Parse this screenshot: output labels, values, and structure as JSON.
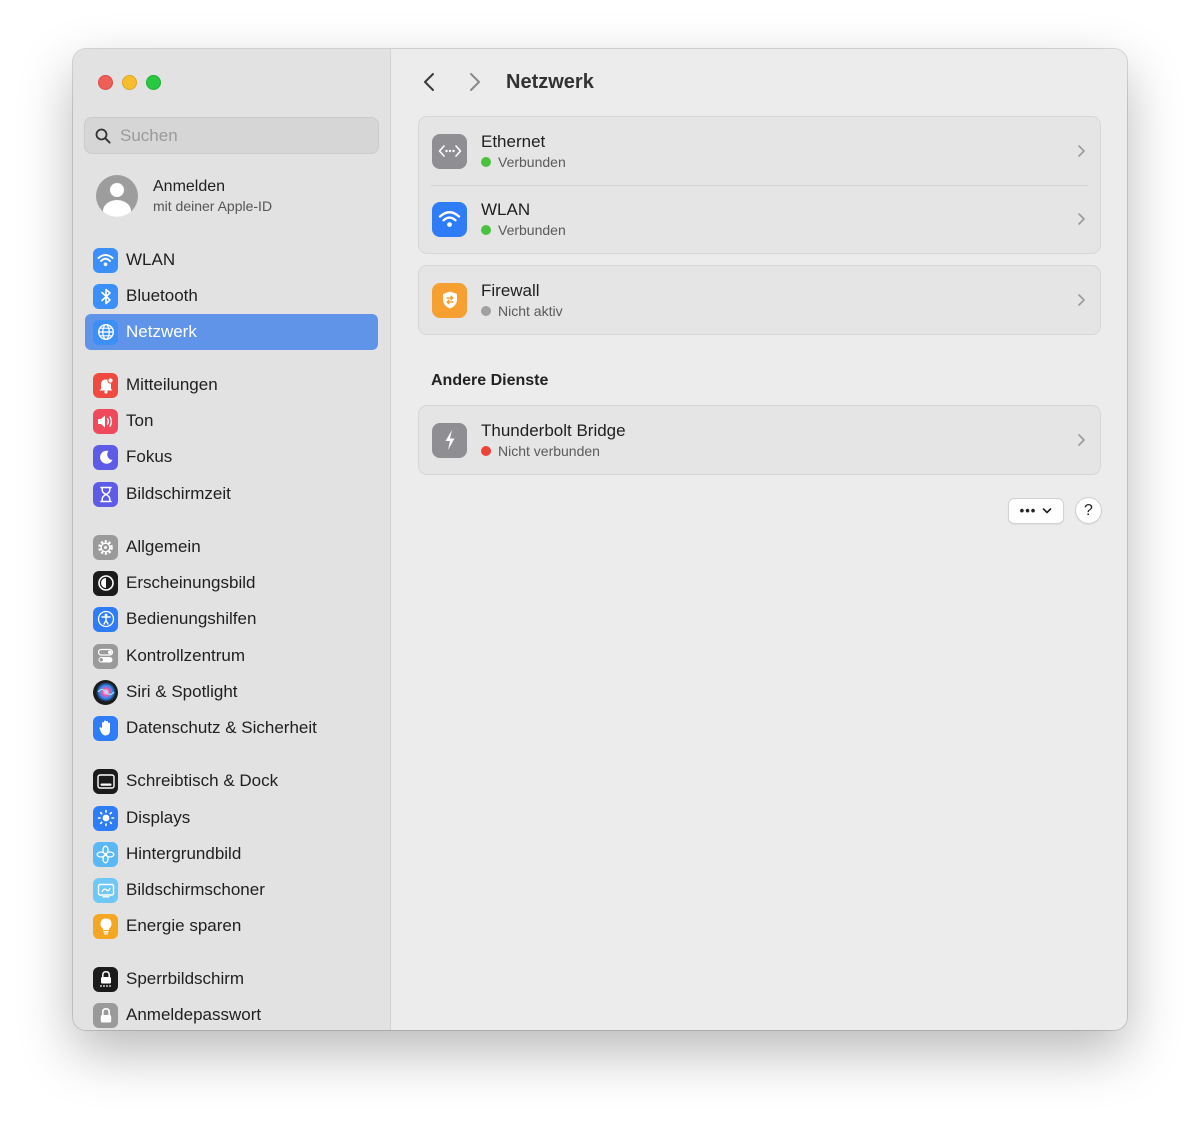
{
  "window": {
    "traffic_lights": [
      "close",
      "minimize",
      "zoom"
    ]
  },
  "sidebar": {
    "search": {
      "placeholder": "Suchen",
      "value": ""
    },
    "account": {
      "title": "Anmelden",
      "subtitle": "mit deiner Apple-ID"
    },
    "items": [
      {
        "label": "WLAN",
        "icon": "wifi-icon",
        "color": "#3b8ff7",
        "active": false
      },
      {
        "label": "Bluetooth",
        "icon": "bluetooth-icon",
        "color": "#3b8ff7",
        "active": false
      },
      {
        "label": "Netzwerk",
        "icon": "globe-icon",
        "color": "#3b8ff7",
        "active": true
      },
      {
        "label": "Mitteilungen",
        "icon": "bell-icon",
        "color": "#ef4a42",
        "active": false
      },
      {
        "label": "Ton",
        "icon": "speaker-icon",
        "color": "#ef4a5c",
        "active": false
      },
      {
        "label": "Fokus",
        "icon": "moon-icon",
        "color": "#5e5ce6",
        "active": false
      },
      {
        "label": "Bildschirmzeit",
        "icon": "hourglass-icon",
        "color": "#5e5ce6",
        "active": false
      },
      {
        "label": "Allgemein",
        "icon": "gear-icon",
        "color": "#9a9a9a",
        "active": false
      },
      {
        "label": "Erscheinungsbild",
        "icon": "appearance-icon",
        "color": "#1b1b1b",
        "active": false
      },
      {
        "label": "Bedienungshilfen",
        "icon": "accessibility-icon",
        "color": "#2f7df6",
        "active": false
      },
      {
        "label": "Kontrollzentrum",
        "icon": "toggles-icon",
        "color": "#9a9a9a",
        "active": false
      },
      {
        "label": "Siri & Spotlight",
        "icon": "siri-icon",
        "color": "#1b1b1b",
        "active": false
      },
      {
        "label": "Datenschutz & Sicherheit",
        "icon": "hand-icon",
        "color": "#2f7df6",
        "active": false
      },
      {
        "label": "Schreibtisch & Dock",
        "icon": "dock-icon",
        "color": "#1b1b1b",
        "active": false
      },
      {
        "label": "Displays",
        "icon": "sun-icon",
        "color": "#2f7df6",
        "active": false
      },
      {
        "label": "Hintergrundbild",
        "icon": "flower-icon",
        "color": "#5ab8f5",
        "active": false
      },
      {
        "label": "Bildschirmschoner",
        "icon": "screensaver-icon",
        "color": "#6fc7f5",
        "active": false
      },
      {
        "label": "Energie sparen",
        "icon": "bulb-icon",
        "color": "#f5a623",
        "active": false
      },
      {
        "label": "Sperrbildschirm",
        "icon": "lock-screen-icon",
        "color": "#1b1b1b",
        "active": false
      },
      {
        "label": "Anmeldepasswort",
        "icon": "lock-icon",
        "color": "#9a9a9a",
        "active": false
      }
    ]
  },
  "main": {
    "title": "Netzwerk",
    "services": [
      {
        "title": "Ethernet",
        "status": "Verbunden",
        "status_color": "#4cc13f",
        "icon": "ethernet-icon",
        "icon_color": "#8e8e93"
      },
      {
        "title": "WLAN",
        "status": "Verbunden",
        "status_color": "#4cc13f",
        "icon": "wifi-icon",
        "icon_color": "#2f7df6"
      }
    ],
    "firewall": {
      "title": "Firewall",
      "status": "Nicht aktiv",
      "status_color": "#a0a0a0",
      "icon": "firewall-icon",
      "icon_color": "#f5a031"
    },
    "other_section_title": "Andere Dienste",
    "other_services": [
      {
        "title": "Thunderbolt Bridge",
        "status": "Nicht verbunden",
        "status_color": "#ee4236",
        "icon": "thunderbolt-icon",
        "icon_color": "#8e8e93"
      }
    ],
    "more_button_label": "•••",
    "help_button_label": "?"
  }
}
